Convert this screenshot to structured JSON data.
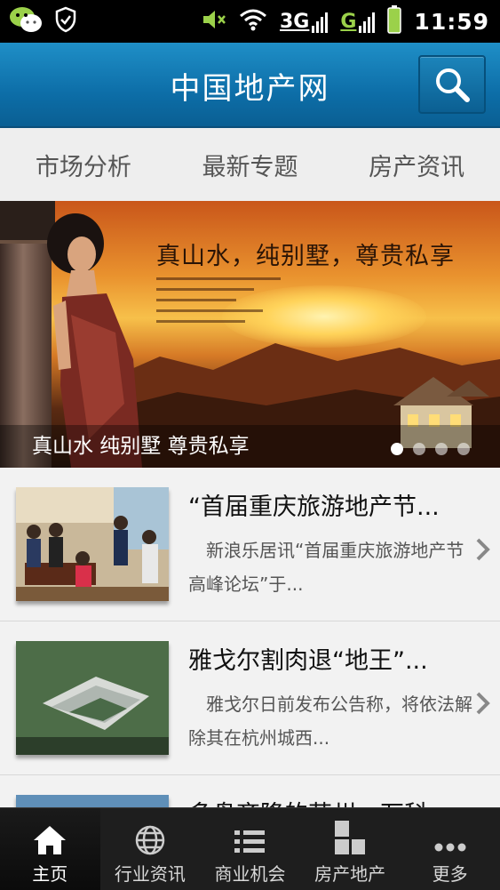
{
  "status_bar": {
    "icons": [
      "wechat-icon",
      "shield-icon",
      "mute-icon",
      "wifi-icon",
      "battery-icon"
    ],
    "network_3g": "3G",
    "network_g": "G",
    "time": "11:59"
  },
  "header": {
    "title": "中国地产网",
    "search_icon": "search-icon"
  },
  "tabs": [
    {
      "label": "市场分析"
    },
    {
      "label": "最新专题"
    },
    {
      "label": "房产资讯"
    }
  ],
  "banner": {
    "headline": "真山水，纯别墅，尊贵私享",
    "caption": "真山水 纯别墅 尊贵私享",
    "slide_count": 4,
    "active_slide": 1
  },
  "news": [
    {
      "title": "“首届重庆旅游地产节...",
      "summary": "新浪乐居讯“首届重庆旅游地产节高峰论坛”于...",
      "thumb": "event-photo"
    },
    {
      "title": "雅戈尔割肉退“地王”...",
      "summary": "雅戈尔日前发布公告称，将依法解除其在杭州城西...",
      "thumb": "aerial-building-photo"
    },
    {
      "title": "多盘齐降的苏州，万科...",
      "summary": "",
      "thumb": "city-photo"
    }
  ],
  "bottom_nav": [
    {
      "label": "主页",
      "icon": "home-icon",
      "active": true
    },
    {
      "label": "行业资讯",
      "icon": "globe-icon",
      "active": false
    },
    {
      "label": "商业机会",
      "icon": "list-icon",
      "active": false
    },
    {
      "label": "房产地产",
      "icon": "blocks-icon",
      "active": false
    },
    {
      "label": "更多",
      "icon": "more-icon",
      "active": false
    }
  ],
  "colors": {
    "header_blue": "#0d6ea8",
    "nav_dark": "#1e1e1e",
    "background": "#ececec"
  }
}
